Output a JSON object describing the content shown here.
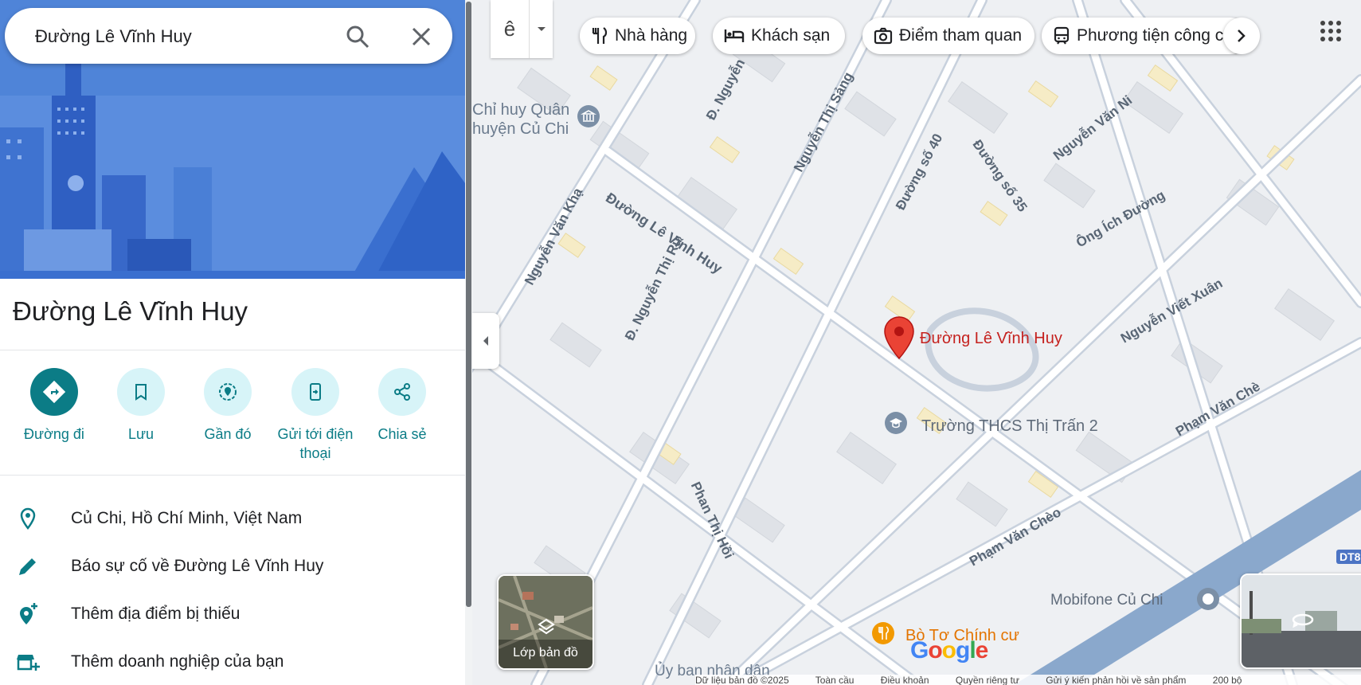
{
  "search": {
    "value": "Đường Lê Vĩnh Huy",
    "search_icon": "search-icon",
    "close_icon": "close-icon"
  },
  "place": {
    "title": "Đường Lê Vĩnh Huy"
  },
  "actions": [
    {
      "label": "Đường đi",
      "icon": "directions-icon"
    },
    {
      "label": "Lưu",
      "icon": "bookmark-icon"
    },
    {
      "label": "Gần đó",
      "icon": "nearby-icon"
    },
    {
      "label": "Gửi tới điện thoại",
      "icon": "send-to-phone-icon"
    },
    {
      "label": "Chia sẻ",
      "icon": "share-icon"
    }
  ],
  "info": [
    {
      "text": "Củ Chi, Hồ Chí Minh, Việt Nam",
      "icon": "location-pin-icon"
    },
    {
      "text": "Báo sự cố về Đường Lê Vĩnh Huy",
      "icon": "pencil-icon"
    },
    {
      "text": "Thêm địa điểm bị thiếu",
      "icon": "add-location-icon"
    },
    {
      "text": "Thêm doanh nghiệp của bạn",
      "icon": "add-business-icon"
    }
  ],
  "map": {
    "lang_button": "ê",
    "chips": [
      {
        "label": "Nhà hàng",
        "icon": "restaurant-icon"
      },
      {
        "label": "Khách sạn",
        "icon": "hotel-icon"
      },
      {
        "label": "Điểm tham quan",
        "icon": "camera-icon"
      },
      {
        "label": "Phương tiện công c",
        "icon": "transit-icon"
      }
    ],
    "pin_label": "Đường Lê Vĩnh Huy",
    "poi": [
      {
        "name": "Trường THCS Thị Trấn 2",
        "icon": "school-icon"
      },
      {
        "name": "Mobifone Củ Chi",
        "icon": "poi-icon"
      },
      {
        "name": "Bò Tơ Chính cư",
        "icon": "restaurant-icon"
      },
      {
        "name": "Chỉ huy Quân",
        "icon": "museum-icon"
      },
      {
        "name": "huyện Củ Chi",
        "icon": ""
      },
      {
        "name": "Ủy ban nhân dân",
        "icon": ""
      }
    ],
    "streets": [
      "Đường Lê Vĩnh Huy",
      "Nguyễn Văn Khạ",
      "Đ. Nguyễn Thị Rư",
      "Nguyễn Thị Sảng",
      "Đường số 40",
      "Đường số 35",
      "Nguyễn Văn Ni",
      "Ông Ích Đường",
      "Nguyễn Viết Xuân",
      "Phạm Văn Chèo",
      "Phan Thị Hồi",
      "Đ. Nguyễn",
      "Phạm Văn Chè"
    ],
    "road_badge": "DT8",
    "layers_label": "Lớp bản đồ",
    "google": "Google",
    "footer": [
      "Dữ liệu bản đồ ©2025",
      "Toàn cầu",
      "Điều khoản",
      "Quyền riêng tư",
      "Gửi ý kiến phản hồi về sản phẩm",
      "200 bộ"
    ]
  },
  "colors": {
    "accent": "#0b7c86",
    "pin": "#d93025",
    "hero": "#5b8dde"
  }
}
